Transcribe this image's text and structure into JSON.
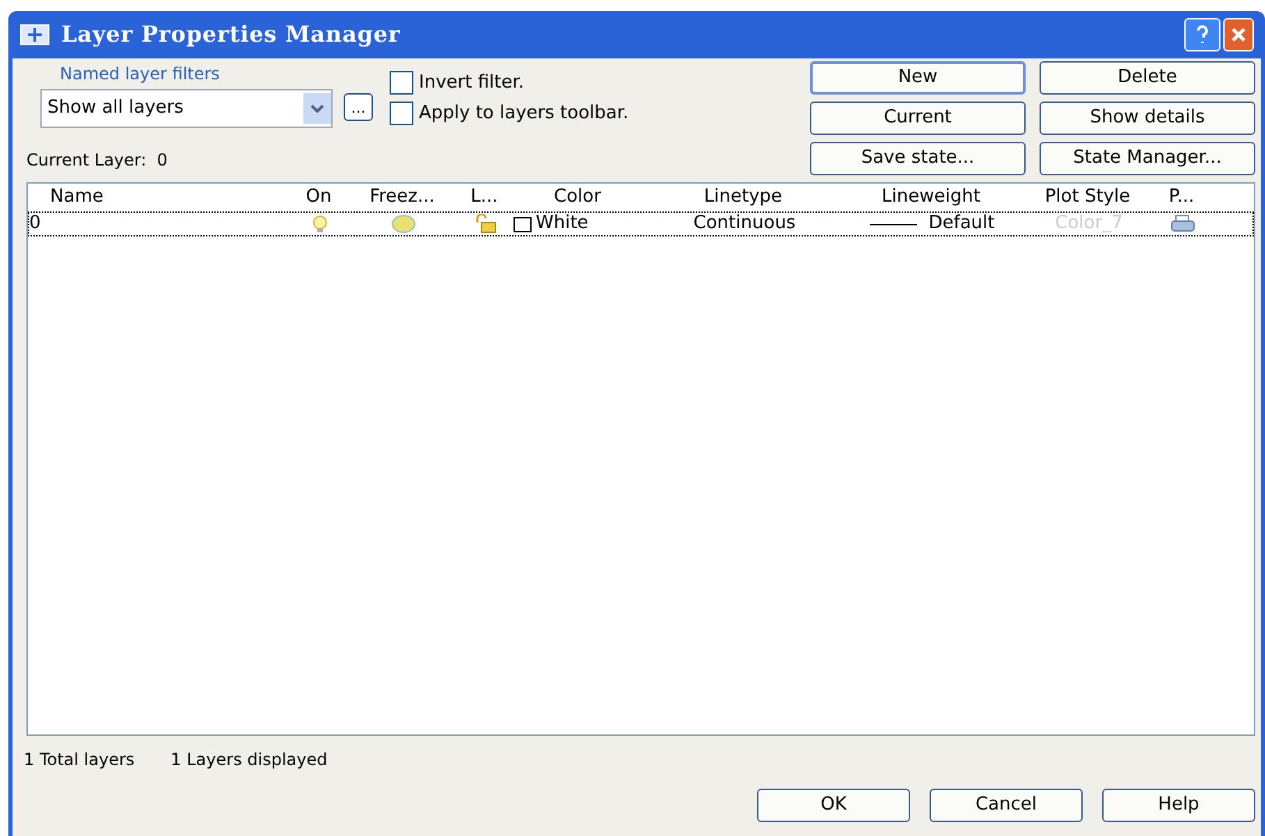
{
  "window": {
    "title": "Layer Properties Manager"
  },
  "filters": {
    "label": "Named layer filters",
    "value": "Show all layers",
    "more": "..."
  },
  "options": [
    {
      "label": "Invert filter.",
      "checked": false
    },
    {
      "label": "Apply to layers toolbar.",
      "checked": false
    }
  ],
  "current_layer": "Current Layer:  0",
  "buttons": [
    {
      "label": "New",
      "default": true
    },
    {
      "label": "Delete",
      "default": false
    },
    {
      "label": "Current",
      "default": false
    },
    {
      "label": "Show details",
      "default": false
    },
    {
      "label": "Save state...",
      "default": false
    },
    {
      "label": "State Manager...",
      "default": false
    }
  ],
  "table": {
    "columns": [
      "Name",
      "On",
      "Freez...",
      "L...",
      "Color",
      "Linetype",
      "Lineweight",
      "Plot Style",
      "P..."
    ],
    "rows": [
      {
        "name": "0",
        "on": true,
        "frozen": false,
        "locked": false,
        "color_name": "White",
        "linetype": "Continuous",
        "lineweight": "Default",
        "plot_style": "Color_7",
        "selected": true
      }
    ]
  },
  "status": [
    "1 Total layers",
    "1 Layers displayed"
  ],
  "footer_buttons": [
    {
      "label": "OK"
    },
    {
      "label": "Cancel"
    },
    {
      "label": "Help"
    }
  ]
}
